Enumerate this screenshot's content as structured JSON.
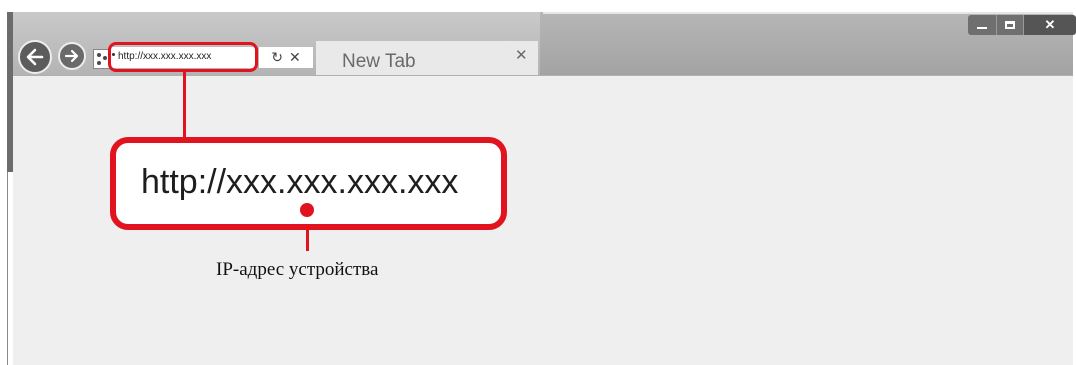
{
  "browser": {
    "address_bar": {
      "url": "http://xxx.xxx.xxx.xxx"
    },
    "address_controls": {
      "refresh_glyph": "↻",
      "stop_glyph": "✕"
    },
    "tab": {
      "label": "New Tab",
      "close_glyph": "✕"
    },
    "window_controls": {
      "close_glyph": "✕"
    }
  },
  "callout": {
    "zoomed_url": "http://xxx.xxx.xxx.xxx",
    "caption": "IP-адрес устройства"
  },
  "icons": [
    "back-arrow-icon",
    "forward-arrow-icon",
    "site-icon",
    "refresh-icon",
    "stop-icon",
    "close-icon",
    "minimize-icon",
    "maximize-icon"
  ],
  "colors": {
    "callout_red": "#e1131f",
    "content_bg": "#efefef",
    "frame_gray": "#a8a8a8"
  }
}
